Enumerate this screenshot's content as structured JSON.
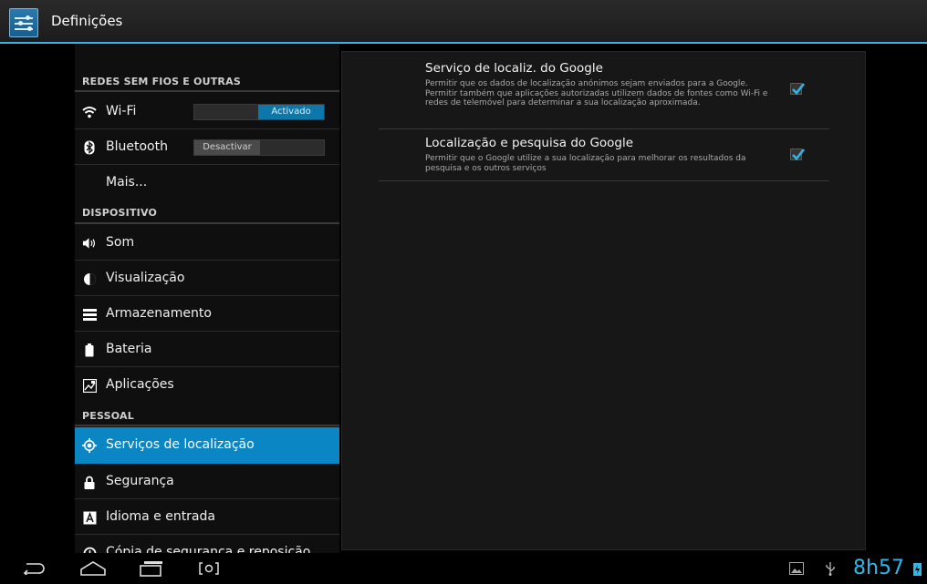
{
  "action_bar": {
    "title": "Definições",
    "icon": "settings-icon"
  },
  "sidebar": {
    "sections": [
      {
        "header": "REDES SEM FIOS E OUTRAS"
      },
      {
        "header": "DISPOSITIVO"
      },
      {
        "header": "PESSOAL"
      }
    ],
    "items": [
      {
        "label": "Wi-Fi",
        "icon": "wifi-icon",
        "toggle": "Activado"
      },
      {
        "label": "Bluetooth",
        "icon": "bluetooth-icon",
        "toggle": "Desactivar"
      },
      {
        "label": "Mais...",
        "icon": ""
      },
      {
        "label": "Som",
        "icon": "speaker-icon"
      },
      {
        "label": "Visualização",
        "icon": "brightness-icon"
      },
      {
        "label": "Armazenamento",
        "icon": "storage-icon"
      },
      {
        "label": "Bateria",
        "icon": "battery-icon"
      },
      {
        "label": "Aplicações",
        "icon": "apps-icon"
      },
      {
        "label": "Serviços de localização",
        "icon": "location-icon",
        "selected": true
      },
      {
        "label": "Segurança",
        "icon": "lock-icon"
      },
      {
        "label": "Idioma e entrada",
        "icon": "language-icon"
      },
      {
        "label": "Cópia de segurança e reposição",
        "icon": "backup-icon"
      }
    ]
  },
  "content": {
    "preferences": [
      {
        "title": "Serviço de localiz. do Google",
        "summary": "Permitir que os dados de localização anónimos sejam enviados para a Google. Permitir também que aplicações autorizadas utilizem dados de fontes como Wi-Fi e redes de telemóvel para determinar a sua localização aproximada.",
        "checked": true
      },
      {
        "title": "Localização e pesquisa do Google",
        "summary": "Permitir que o Google utilize a sua localização para melhorar os resultados da pesquisa e os outros serviços",
        "checked": true
      }
    ]
  },
  "nav_bar": {
    "buttons": [
      "back-icon",
      "home-icon",
      "recent-apps-icon",
      "screenshot-icon"
    ],
    "status_icons": [
      "gallery-icon",
      "usb-icon",
      "battery-charging-icon"
    ],
    "clock": "8h57"
  },
  "colors": {
    "accent": "#33b5e5",
    "selected": "#0a86c4"
  }
}
